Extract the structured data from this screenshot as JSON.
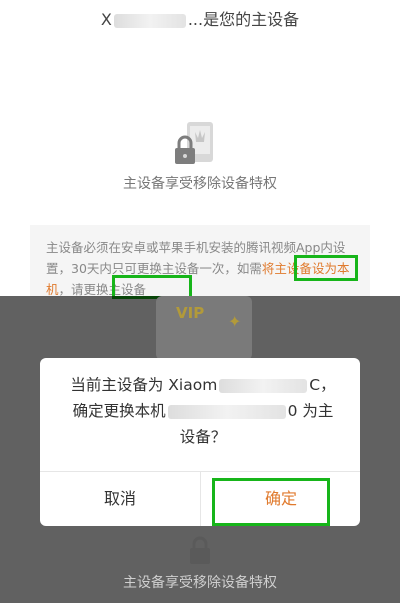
{
  "header": {
    "title_prefix": "X",
    "title_suffix": "...是您的主设备"
  },
  "feature": {
    "caption": "主设备享受移除设备特权",
    "icon": "device-lock-crown-icon"
  },
  "notice": {
    "text_part1": "主设备必须在安卓或苹果手机安装的腾讯视频App内设置，30天内只可更换主设备一次，如需",
    "link_part1": "将主设备",
    "link_part2": "设为本机",
    "text_part2": "，请更换主设备"
  },
  "background_card": {
    "badge": "VIP",
    "sparkle": "✦"
  },
  "dialog": {
    "line1_prefix": "当前主设备为 Xiaom",
    "line1_suffix": "C，",
    "line2_prefix": "确定更换本机",
    "line2_suffix": "0 为主",
    "line3": "设备？",
    "cancel_label": "取消",
    "confirm_label": "确定"
  },
  "bottom": {
    "caption": "主设备享受移除设备特权"
  },
  "colors": {
    "accent": "#e07a2d",
    "highlight_box": "#17b51a",
    "overlay": "#000000"
  }
}
